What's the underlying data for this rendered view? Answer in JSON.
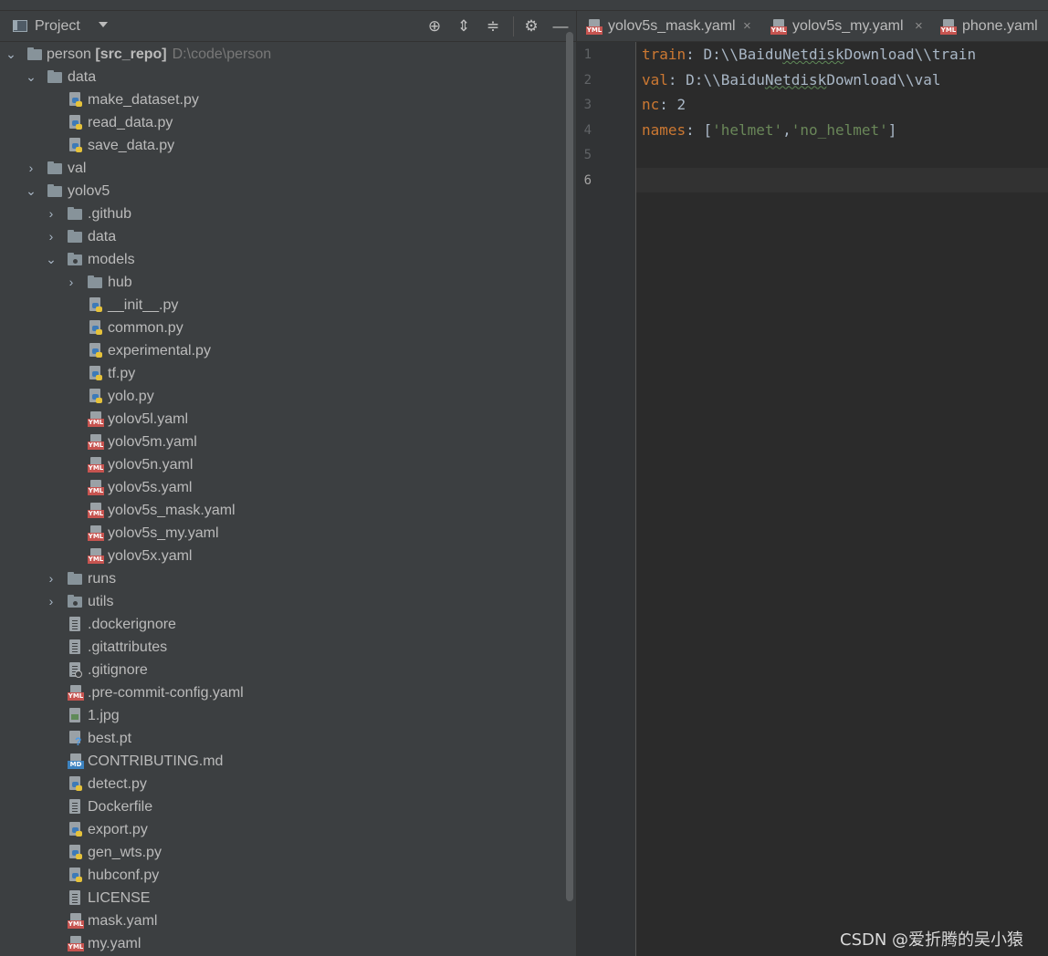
{
  "project_panel": {
    "title": "Project",
    "toolbar": [
      "locate-icon",
      "expand-all-icon",
      "collapse-all-icon",
      "gear-icon",
      "hide-icon"
    ],
    "root": {
      "name": "person",
      "module": "[src_repo]",
      "path": "D:\\code\\person"
    },
    "tree": [
      {
        "label": "data",
        "type": "folder",
        "depth": 1,
        "state": "open"
      },
      {
        "label": "make_dataset.py",
        "type": "py",
        "depth": 2
      },
      {
        "label": "read_data.py",
        "type": "py",
        "depth": 2
      },
      {
        "label": "save_data.py",
        "type": "py",
        "depth": 2
      },
      {
        "label": "val",
        "type": "folder",
        "depth": 1,
        "state": "closed"
      },
      {
        "label": "yolov5",
        "type": "folder",
        "depth": 1,
        "state": "open"
      },
      {
        "label": ".github",
        "type": "folder",
        "depth": 2,
        "state": "closed"
      },
      {
        "label": "data",
        "type": "folder",
        "depth": 2,
        "state": "closed"
      },
      {
        "label": "models",
        "type": "pkg",
        "depth": 2,
        "state": "open"
      },
      {
        "label": "hub",
        "type": "folder",
        "depth": 3,
        "state": "closed"
      },
      {
        "label": "__init__.py",
        "type": "py",
        "depth": 3
      },
      {
        "label": "common.py",
        "type": "py",
        "depth": 3
      },
      {
        "label": "experimental.py",
        "type": "py",
        "depth": 3
      },
      {
        "label": "tf.py",
        "type": "py",
        "depth": 3
      },
      {
        "label": "yolo.py",
        "type": "py",
        "depth": 3
      },
      {
        "label": "yolov5l.yaml",
        "type": "yml",
        "depth": 3
      },
      {
        "label": "yolov5m.yaml",
        "type": "yml",
        "depth": 3
      },
      {
        "label": "yolov5n.yaml",
        "type": "yml",
        "depth": 3
      },
      {
        "label": "yolov5s.yaml",
        "type": "yml",
        "depth": 3
      },
      {
        "label": "yolov5s_mask.yaml",
        "type": "yml",
        "depth": 3
      },
      {
        "label": "yolov5s_my.yaml",
        "type": "yml",
        "depth": 3
      },
      {
        "label": "yolov5x.yaml",
        "type": "yml",
        "depth": 3
      },
      {
        "label": "runs",
        "type": "folder",
        "depth": 2,
        "state": "closed"
      },
      {
        "label": "utils",
        "type": "pkg",
        "depth": 2,
        "state": "closed"
      },
      {
        "label": ".dockerignore",
        "type": "file",
        "depth": 2
      },
      {
        "label": ".gitattributes",
        "type": "file",
        "depth": 2
      },
      {
        "label": ".gitignore",
        "type": "ign",
        "depth": 2
      },
      {
        "label": ".pre-commit-config.yaml",
        "type": "yml",
        "depth": 2
      },
      {
        "label": "1.jpg",
        "type": "img",
        "depth": 2
      },
      {
        "label": "best.pt",
        "type": "unk",
        "depth": 2
      },
      {
        "label": "CONTRIBUTING.md",
        "type": "md",
        "depth": 2
      },
      {
        "label": "detect.py",
        "type": "py",
        "depth": 2
      },
      {
        "label": "Dockerfile",
        "type": "file",
        "depth": 2
      },
      {
        "label": "export.py",
        "type": "py",
        "depth": 2
      },
      {
        "label": "gen_wts.py",
        "type": "py",
        "depth": 2
      },
      {
        "label": "hubconf.py",
        "type": "py",
        "depth": 2
      },
      {
        "label": "LICENSE",
        "type": "file",
        "depth": 2
      },
      {
        "label": "mask.yaml",
        "type": "yml",
        "depth": 2
      },
      {
        "label": "my.yaml",
        "type": "yml",
        "depth": 2
      }
    ]
  },
  "editor": {
    "tabs": [
      {
        "label": "yolov5s_mask.yaml",
        "closable": true
      },
      {
        "label": "yolov5s_my.yaml",
        "closable": true
      },
      {
        "label": "phone.yaml",
        "closable": false
      }
    ],
    "icon_badge": "YML",
    "close_glyph": "×",
    "line_numbers": [
      "1",
      "2",
      "3",
      "4",
      "5",
      "6"
    ],
    "current_line": 6,
    "lines": [
      [
        {
          "t": "train",
          "c": "k"
        },
        {
          "t": ": D:\\\\"
        },
        {
          "t": "BaiduNetdisk",
          "w": "Netdisk"
        },
        {
          "t": "Download\\\\train"
        }
      ],
      [
        {
          "t": "val",
          "c": "k"
        },
        {
          "t": ": D:\\\\"
        },
        {
          "t": "BaiduNetdisk",
          "w": "Netdisk"
        },
        {
          "t": "Download\\\\val"
        }
      ],
      [
        {
          "t": "nc",
          "c": "k"
        },
        {
          "t": ": 2"
        }
      ],
      [
        {
          "t": "names",
          "c": "k"
        },
        {
          "t": ": ["
        },
        {
          "t": "'helmet'",
          "c": "s"
        },
        {
          "t": ","
        },
        {
          "t": "'no_helmet'",
          "c": "s"
        },
        {
          "t": "]"
        }
      ],
      [],
      []
    ]
  },
  "watermark": "CSDN @爱折腾的吴小猿",
  "colors": {
    "keyword": "#cc7832",
    "string": "#6a8759",
    "text": "#a9b7c6",
    "panel_bg": "#3c3f41",
    "editor_bg": "#2b2b2b"
  }
}
